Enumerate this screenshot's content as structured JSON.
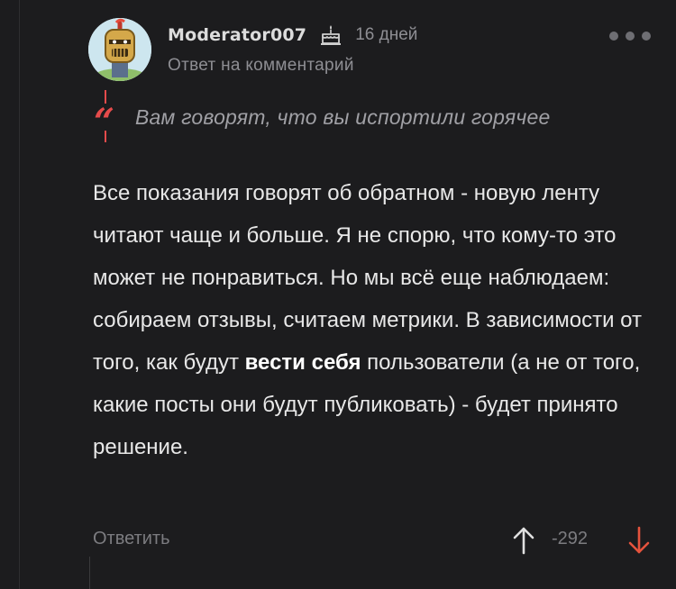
{
  "comment": {
    "author": "Moderator007",
    "timestamp": "16 дней",
    "subtitle": "Ответ на комментарий",
    "quote": "Вам говорят, что вы испортили горячее",
    "body": {
      "part1": "Все показания говорят об обратном - новую ленту читают чаще и больше. Я не спорю, что кому-то это может не понравиться. Но мы всё еще наблюдаем: собираем отзывы, считаем метрики. В зависимости от того, как будут ",
      "bold": "вести себя",
      "part2": " пользователи (а не от того, какие посты они будут публиковать) - будет принято решение."
    },
    "reply_label": "Ответить",
    "score": "-292"
  },
  "icons": {
    "cake": "cake-icon",
    "more": "more-options-icon",
    "quote": "quote-icon",
    "upvote": "arrow-up-icon",
    "downvote": "arrow-down-icon"
  },
  "colors": {
    "background": "#1c1c1e",
    "accent_red": "#e54b4b",
    "muted": "#8e8e93",
    "upvote": "#e0e0e0",
    "downvote": "#e5533d"
  }
}
